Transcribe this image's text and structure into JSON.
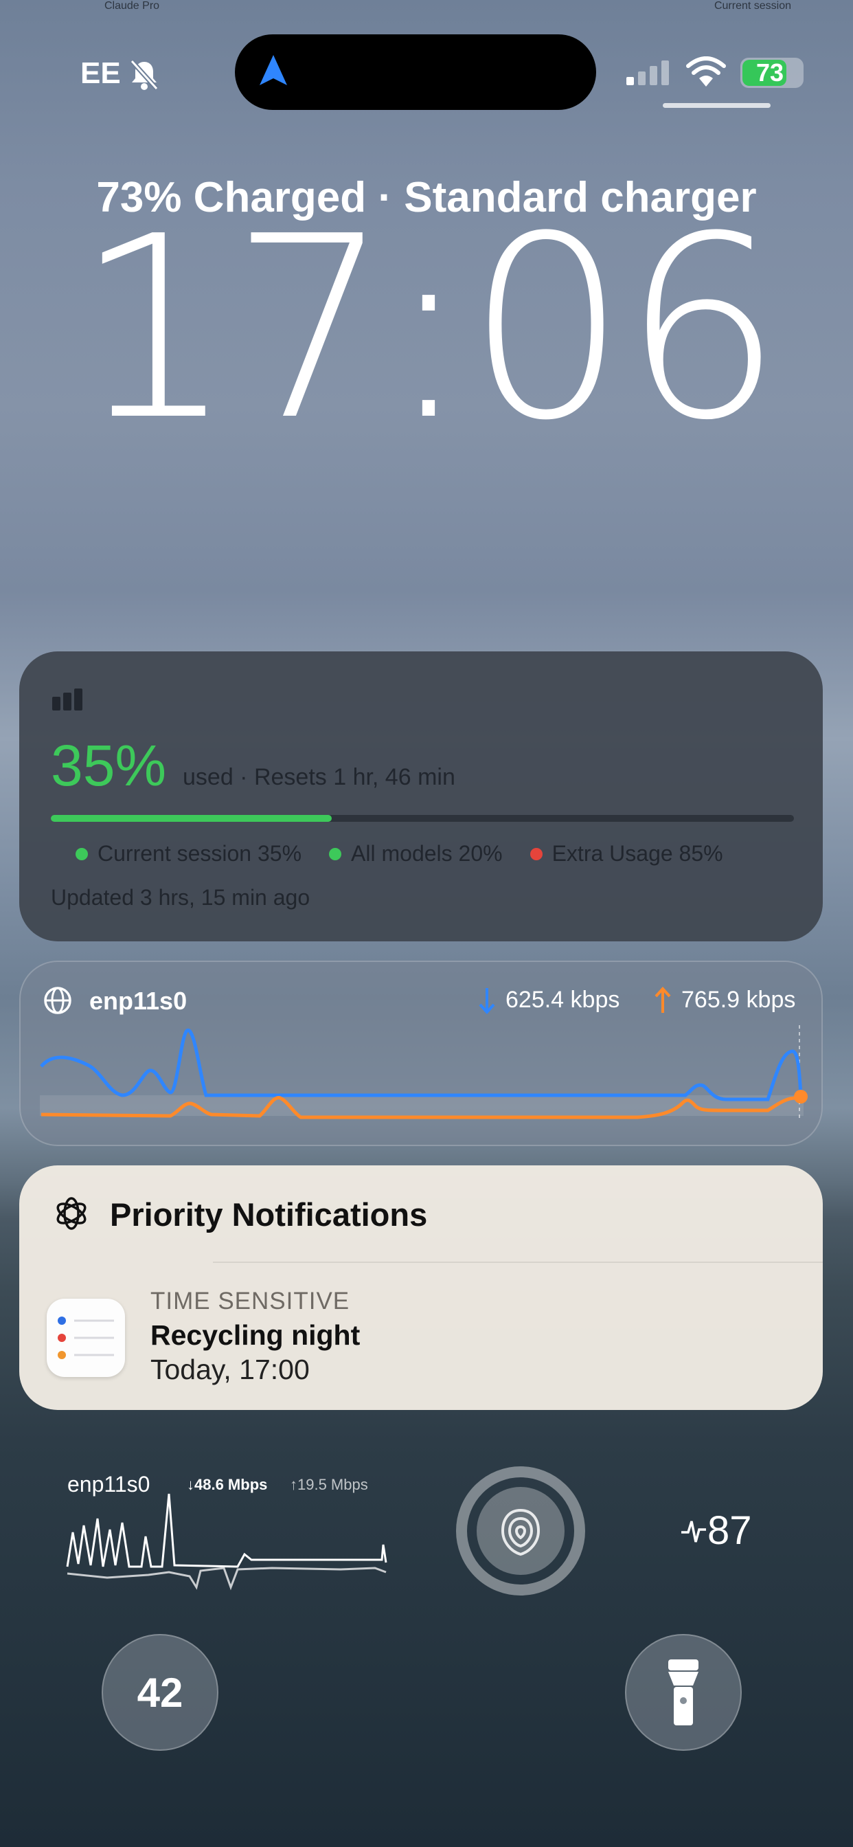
{
  "status_bar": {
    "carrier": "EE",
    "battery_percent": "73",
    "icons": [
      "bell-slash-icon",
      "location-arrow-icon",
      "signal-icon",
      "wifi-icon",
      "battery-charging-icon"
    ]
  },
  "lock": {
    "charge_status": "73% Charged · Standard charger",
    "time": "17:06"
  },
  "claude_widget": {
    "name": "Claude Pro",
    "scope": "Current session",
    "percent": "35%",
    "used_text": "used · Resets 1 hr, 46 min",
    "progress": 0.35,
    "legend": [
      {
        "label": "Current session 35%",
        "color": "#3dc95a"
      },
      {
        "label": "All models 20%",
        "color": "#3dc95a"
      },
      {
        "label": "Extra Usage 85%",
        "color": "#e5443b"
      }
    ],
    "updated": "Updated 3 hrs, 15 min ago"
  },
  "net_widget": {
    "interface": "enp11s0",
    "down_rate": "625.4 kbps",
    "up_rate": "765.9 kbps",
    "down_color": "#2f86ff",
    "up_color": "#ff8a2a"
  },
  "notification": {
    "title": "Priority Notifications",
    "kind": "TIME SENSITIVE",
    "headline": "Recycling night",
    "time": "Today, 17:00",
    "app_icon": "reminders-icon"
  },
  "bottom_widgets": {
    "net": {
      "interface": "enp11s0",
      "down_rate": "↓48.6 Mbps",
      "up_rate": "↑19.5 Mbps"
    },
    "heart_rate": "87",
    "focus_icon": "fingerprint-focus-icon"
  },
  "quick_actions": {
    "left_value": "42",
    "right_icon": "flashlight-icon"
  }
}
